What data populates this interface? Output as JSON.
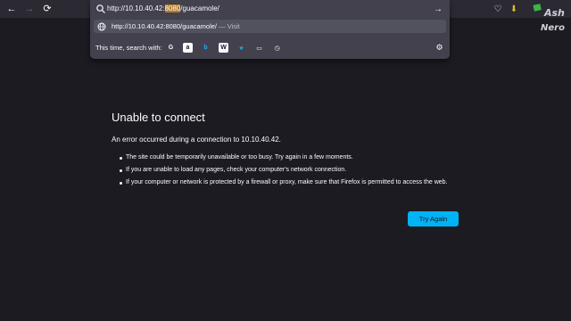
{
  "urlbar": {
    "value_prefix": "http://10.10.40.42:",
    "value_selected": "8080",
    "value_suffix": "/guacamole/",
    "suggestion_url": "http://10.10.40.42:8080/guacamole/",
    "suggestion_action": "— Visit",
    "search_with_label": "This time, search with:",
    "engines": [
      {
        "name": "google-engine-icon",
        "glyph": "G"
      },
      {
        "name": "amazon-engine-icon",
        "glyph": "a"
      },
      {
        "name": "bing-engine-icon",
        "glyph": "b"
      },
      {
        "name": "wikipedia-engine-icon",
        "glyph": "W"
      },
      {
        "name": "bookmarks-icon",
        "glyph": "★"
      },
      {
        "name": "tabs-icon",
        "glyph": "▭"
      },
      {
        "name": "history-icon",
        "glyph": "◷"
      }
    ]
  },
  "error": {
    "title": "Unable to connect",
    "description": "An error occurred during a connection to 10.10.40.42.",
    "items": [
      "The site could be temporarily unavailable or too busy. Try again in a few moments.",
      "If you are unable to load any pages, check your computer's network connection.",
      "If your computer or network is protected by a firewall or proxy, make sure that Firefox is permitted to access the web."
    ],
    "button_label": "Try Again"
  },
  "watermark": {
    "text_top": "Ash",
    "text_bottom": "Nero"
  },
  "colors": {
    "background": "#1c1b22",
    "toolbar": "#2b2a33",
    "urlbar": "#42414d",
    "accent_button": "#00b3f4",
    "highlight": "#b57c2a"
  }
}
